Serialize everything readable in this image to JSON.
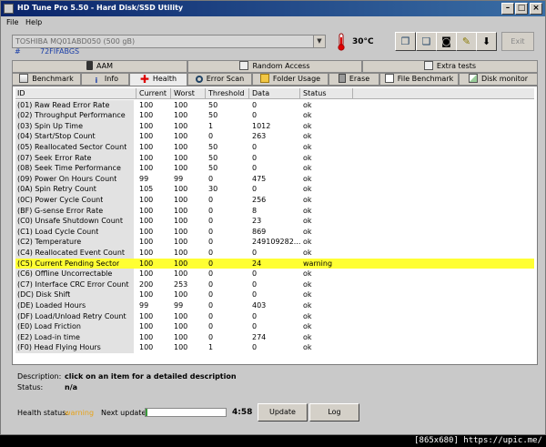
{
  "window": {
    "title": "HD Tune Pro 5.50 - Hard Disk/SSD Utility"
  },
  "menu": [
    "File",
    "Help"
  ],
  "toolbar": {
    "drive": "TOSHIBA MQ01ABD050 (500 gB)",
    "temperature": "30°C",
    "exit_label": "Exit"
  },
  "serial": {
    "label": "#",
    "value": "72FIFABGS"
  },
  "tabs_top": [
    {
      "label": "AAM",
      "icon": "speaker-icon"
    },
    {
      "label": "Random Access",
      "icon": "grid-icon"
    },
    {
      "label": "Extra tests",
      "icon": "grid-icon"
    }
  ],
  "tabs_bottom": [
    {
      "label": "Benchmark",
      "icon": "chart-icon"
    },
    {
      "label": "Info",
      "icon": "info-icon"
    },
    {
      "label": "Health",
      "icon": "red-cross-icon",
      "active": true
    },
    {
      "label": "Error Scan",
      "icon": "magnifier-icon"
    },
    {
      "label": "Folder Usage",
      "icon": "folder-icon"
    },
    {
      "label": "Erase",
      "icon": "trash-icon"
    },
    {
      "label": "File Benchmark",
      "icon": "file-chart-icon"
    },
    {
      "label": "Disk monitor",
      "icon": "monitor-chart-icon"
    }
  ],
  "table": {
    "columns": [
      "ID",
      "Current",
      "Worst",
      "Threshold",
      "Data",
      "Status"
    ],
    "rows": [
      [
        "(01) Raw Read Error Rate",
        "100",
        "100",
        "50",
        "0",
        "ok"
      ],
      [
        "(02) Throughput Performance",
        "100",
        "100",
        "50",
        "0",
        "ok"
      ],
      [
        "(03) Spin Up Time",
        "100",
        "100",
        "1",
        "1012",
        "ok"
      ],
      [
        "(04) Start/Stop Count",
        "100",
        "100",
        "0",
        "263",
        "ok"
      ],
      [
        "(05) Reallocated Sector Count",
        "100",
        "100",
        "50",
        "0",
        "ok"
      ],
      [
        "(07) Seek Error Rate",
        "100",
        "100",
        "50",
        "0",
        "ok"
      ],
      [
        "(08) Seek Time Performance",
        "100",
        "100",
        "50",
        "0",
        "ok"
      ],
      [
        "(09) Power On Hours Count",
        "99",
        "99",
        "0",
        "475",
        "ok"
      ],
      [
        "(0A) Spin Retry Count",
        "105",
        "100",
        "30",
        "0",
        "ok"
      ],
      [
        "(0C) Power Cycle Count",
        "100",
        "100",
        "0",
        "256",
        "ok"
      ],
      [
        "(BF) G-sense Error Rate",
        "100",
        "100",
        "0",
        "8",
        "ok"
      ],
      [
        "(C0) Unsafe Shutdown Count",
        "100",
        "100",
        "0",
        "23",
        "ok"
      ],
      [
        "(C1) Load Cycle Count",
        "100",
        "100",
        "0",
        "869",
        "ok"
      ],
      [
        "(C2) Temperature",
        "100",
        "100",
        "0",
        "249109282...",
        "ok"
      ],
      [
        "(C4) Reallocated Event Count",
        "100",
        "100",
        "0",
        "0",
        "ok"
      ],
      [
        "(C5) Current Pending Sector",
        "100",
        "100",
        "0",
        "24",
        "warning"
      ],
      [
        "(C6) Offline Uncorrectable",
        "100",
        "100",
        "0",
        "0",
        "ok"
      ],
      [
        "(C7) Interface CRC Error Count",
        "200",
        "253",
        "0",
        "0",
        "ok"
      ],
      [
        "(DC) Disk Shift",
        "100",
        "100",
        "0",
        "0",
        "ok"
      ],
      [
        "(DE) Loaded Hours",
        "99",
        "99",
        "0",
        "403",
        "ok"
      ],
      [
        "(DF) Load/Unload Retry Count",
        "100",
        "100",
        "0",
        "0",
        "ok"
      ],
      [
        "(E0) Load Friction",
        "100",
        "100",
        "0",
        "0",
        "ok"
      ],
      [
        "(E2) Load-in time",
        "100",
        "100",
        "0",
        "274",
        "ok"
      ],
      [
        "(F0) Head Flying Hours",
        "100",
        "100",
        "1",
        "0",
        "ok"
      ]
    ]
  },
  "description": {
    "label": "Description:",
    "value": "click on an item for a detailed description",
    "status_label": "Status:",
    "status_value": "n/a"
  },
  "status": {
    "health_label": "Health status:",
    "health_value": "warning",
    "next_update_label": "Next update:",
    "progress": 0.02,
    "time": "4:58",
    "update_label": "Update",
    "log_label": "Log"
  },
  "colors": {
    "warning_text": "#e8a317",
    "warning_row": "#ffff33"
  },
  "footer": "[865x680] https://upic.me/"
}
